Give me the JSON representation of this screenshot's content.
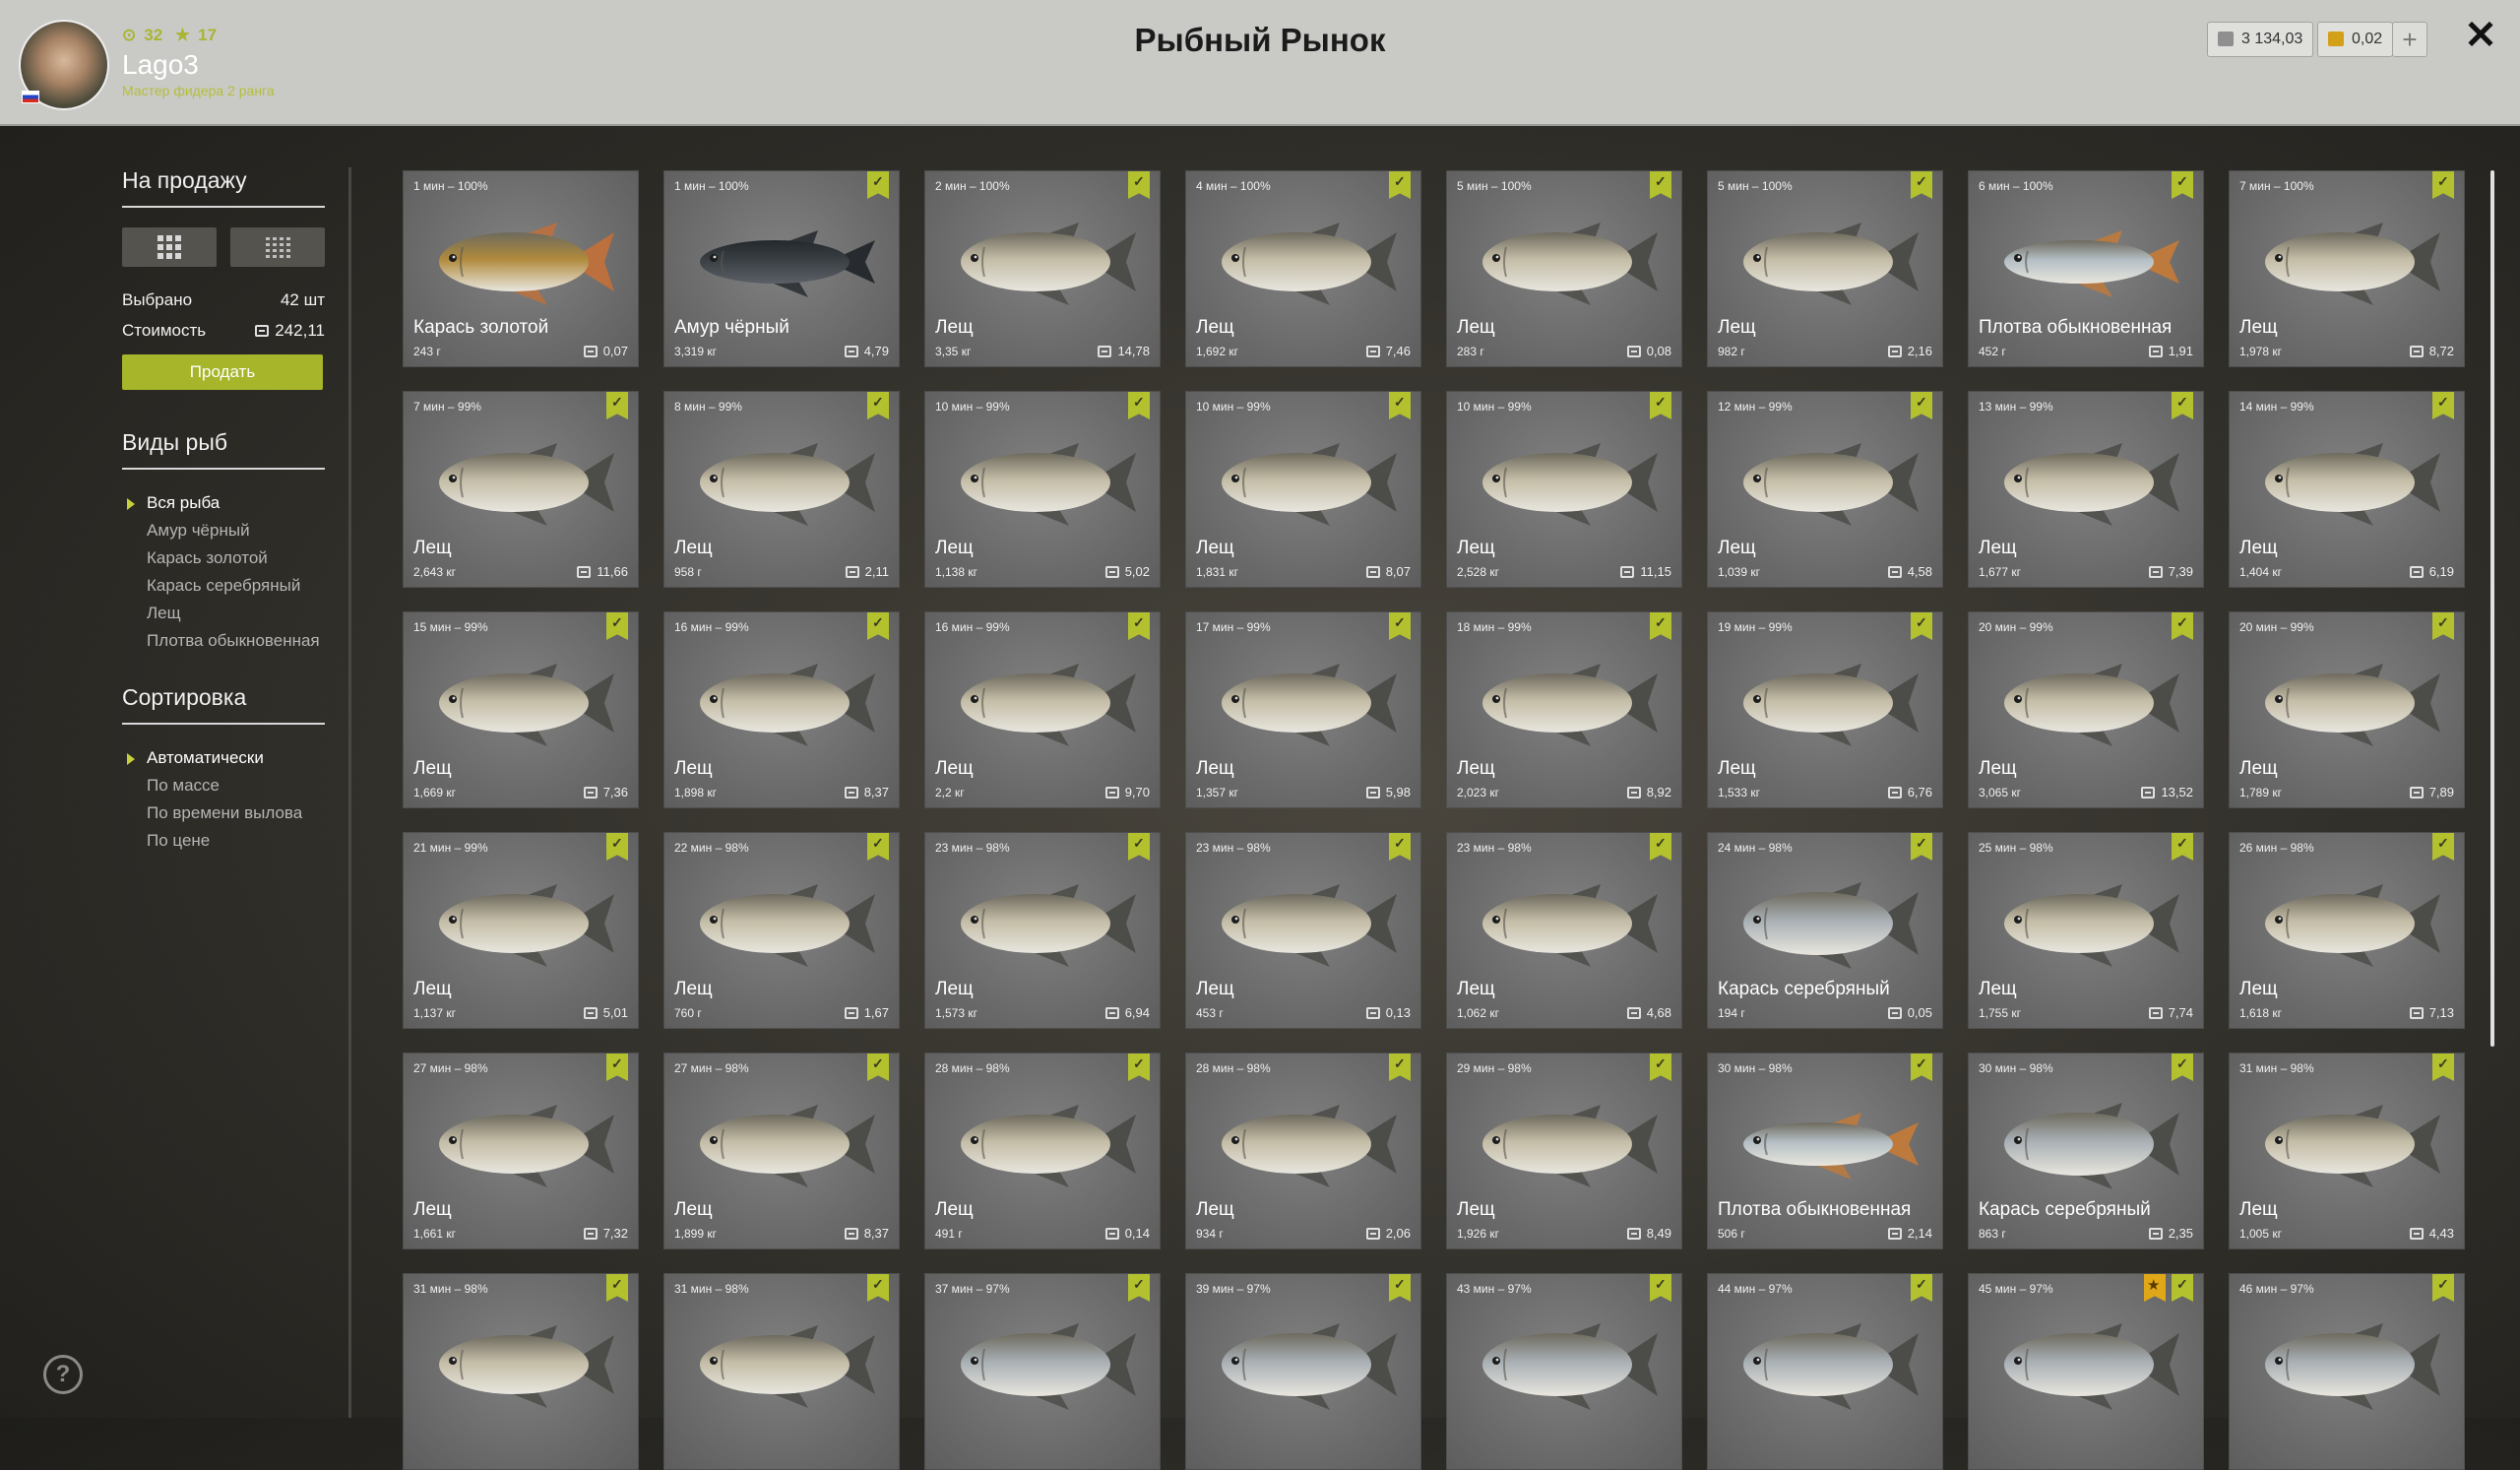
{
  "header": {
    "title": "Рыбный Рынок",
    "player": {
      "name": "Lago3",
      "level": "32",
      "stars": "17",
      "rank": "Мастер фидера 2 ранга"
    },
    "currency": [
      {
        "value": "3 134,03",
        "icon": "silver-icon",
        "color": "#8f8f8f"
      },
      {
        "value": "0,02",
        "icon": "gold-icon",
        "color": "#d2a019"
      }
    ],
    "plus_label": "+",
    "close_label": "✕"
  },
  "sidebar": {
    "sale_title": "На продажу",
    "selected_label": "Выбрано",
    "selected_value": "42 шт",
    "cost_label": "Стоимость",
    "cost_value": "242,11",
    "sell_label": "Продать",
    "species_title": "Виды рыб",
    "species": [
      "Вся рыба",
      "Амур чёрный",
      "Карась золотой",
      "Карась серебряный",
      "Лещ",
      "Плотва обыкновенная"
    ],
    "species_active": 0,
    "sort_title": "Сортировка",
    "sort": [
      "Автоматически",
      "По массе",
      "По времени вылова",
      "По цене"
    ],
    "sort_active": 0
  },
  "help_label": "?",
  "fish_colors": {
    "gold": "#b08a3c",
    "dark": "#3a3f44",
    "bream": "#c3bca6",
    "roach": "#b4bec4",
    "silver": "#a8afb4"
  },
  "cards": [
    {
      "time": "1 мин – 100%",
      "name": "Карась золотой",
      "weight": "243 г",
      "price": "0,07",
      "kind": "gold",
      "check": false
    },
    {
      "time": "1 мин – 100%",
      "name": "Амур чёрный",
      "weight": "3,319 кг",
      "price": "4,79",
      "kind": "dark",
      "check": true
    },
    {
      "time": "2 мин – 100%",
      "name": "Лещ",
      "weight": "3,35 кг",
      "price": "14,78",
      "kind": "bream",
      "check": true
    },
    {
      "time": "4 мин – 100%",
      "name": "Лещ",
      "weight": "1,692 кг",
      "price": "7,46",
      "kind": "bream",
      "check": true
    },
    {
      "time": "5 мин – 100%",
      "name": "Лещ",
      "weight": "283 г",
      "price": "0,08",
      "kind": "bream",
      "check": true
    },
    {
      "time": "5 мин – 100%",
      "name": "Лещ",
      "weight": "982 г",
      "price": "2,16",
      "kind": "bream",
      "check": true
    },
    {
      "time": "6 мин – 100%",
      "name": "Плотва обыкновенная",
      "weight": "452 г",
      "price": "1,91",
      "kind": "roach",
      "check": true
    },
    {
      "time": "7 мин – 100%",
      "name": "Лещ",
      "weight": "1,978 кг",
      "price": "8,72",
      "kind": "bream",
      "check": true
    },
    {
      "time": "7 мин – 99%",
      "name": "Лещ",
      "weight": "2,643 кг",
      "price": "11,66",
      "kind": "bream",
      "check": true
    },
    {
      "time": "8 мин – 99%",
      "name": "Лещ",
      "weight": "958 г",
      "price": "2,11",
      "kind": "bream",
      "check": true
    },
    {
      "time": "10 мин – 99%",
      "name": "Лещ",
      "weight": "1,138 кг",
      "price": "5,02",
      "kind": "bream",
      "check": true
    },
    {
      "time": "10 мин – 99%",
      "name": "Лещ",
      "weight": "1,831 кг",
      "price": "8,07",
      "kind": "bream",
      "check": true
    },
    {
      "time": "10 мин – 99%",
      "name": "Лещ",
      "weight": "2,528 кг",
      "price": "11,15",
      "kind": "bream",
      "check": true
    },
    {
      "time": "12 мин – 99%",
      "name": "Лещ",
      "weight": "1,039 кг",
      "price": "4,58",
      "kind": "bream",
      "check": true
    },
    {
      "time": "13 мин – 99%",
      "name": "Лещ",
      "weight": "1,677 кг",
      "price": "7,39",
      "kind": "bream",
      "check": true
    },
    {
      "time": "14 мин – 99%",
      "name": "Лещ",
      "weight": "1,404 кг",
      "price": "6,19",
      "kind": "bream",
      "check": true
    },
    {
      "time": "15 мин – 99%",
      "name": "Лещ",
      "weight": "1,669 кг",
      "price": "7,36",
      "kind": "bream",
      "check": true
    },
    {
      "time": "16 мин – 99%",
      "name": "Лещ",
      "weight": "1,898 кг",
      "price": "8,37",
      "kind": "bream",
      "check": true
    },
    {
      "time": "16 мин – 99%",
      "name": "Лещ",
      "weight": "2,2 кг",
      "price": "9,70",
      "kind": "bream",
      "check": true
    },
    {
      "time": "17 мин – 99%",
      "name": "Лещ",
      "weight": "1,357 кг",
      "price": "5,98",
      "kind": "bream",
      "check": true
    },
    {
      "time": "18 мин – 99%",
      "name": "Лещ",
      "weight": "2,023 кг",
      "price": "8,92",
      "kind": "bream",
      "check": true
    },
    {
      "time": "19 мин – 99%",
      "name": "Лещ",
      "weight": "1,533 кг",
      "price": "6,76",
      "kind": "bream",
      "check": true
    },
    {
      "time": "20 мин – 99%",
      "name": "Лещ",
      "weight": "3,065 кг",
      "price": "13,52",
      "kind": "bream",
      "check": true
    },
    {
      "time": "20 мин – 99%",
      "name": "Лещ",
      "weight": "1,789 кг",
      "price": "7,89",
      "kind": "bream",
      "check": true
    },
    {
      "time": "21 мин – 99%",
      "name": "Лещ",
      "weight": "1,137 кг",
      "price": "5,01",
      "kind": "bream",
      "check": true
    },
    {
      "time": "22 мин – 98%",
      "name": "Лещ",
      "weight": "760 г",
      "price": "1,67",
      "kind": "bream",
      "check": true
    },
    {
      "time": "23 мин – 98%",
      "name": "Лещ",
      "weight": "1,573 кг",
      "price": "6,94",
      "kind": "bream",
      "check": true
    },
    {
      "time": "23 мин – 98%",
      "name": "Лещ",
      "weight": "453 г",
      "price": "0,13",
      "kind": "bream",
      "check": true
    },
    {
      "time": "23 мин – 98%",
      "name": "Лещ",
      "weight": "1,062 кг",
      "price": "4,68",
      "kind": "bream",
      "check": true
    },
    {
      "time": "24 мин – 98%",
      "name": "Карась серебряный",
      "weight": "194 г",
      "price": "0,05",
      "kind": "silver",
      "check": true
    },
    {
      "time": "25 мин – 98%",
      "name": "Лещ",
      "weight": "1,755 кг",
      "price": "7,74",
      "kind": "bream",
      "check": true
    },
    {
      "time": "26 мин – 98%",
      "name": "Лещ",
      "weight": "1,618 кг",
      "price": "7,13",
      "kind": "bream",
      "check": true
    },
    {
      "time": "27 мин – 98%",
      "name": "Лещ",
      "weight": "1,661 кг",
      "price": "7,32",
      "kind": "bream",
      "check": true
    },
    {
      "time": "27 мин – 98%",
      "name": "Лещ",
      "weight": "1,899 кг",
      "price": "8,37",
      "kind": "bream",
      "check": true
    },
    {
      "time": "28 мин – 98%",
      "name": "Лещ",
      "weight": "491 г",
      "price": "0,14",
      "kind": "bream",
      "check": true
    },
    {
      "time": "28 мин – 98%",
      "name": "Лещ",
      "weight": "934 г",
      "price": "2,06",
      "kind": "bream",
      "check": true
    },
    {
      "time": "29 мин – 98%",
      "name": "Лещ",
      "weight": "1,926 кг",
      "price": "8,49",
      "kind": "bream",
      "check": true
    },
    {
      "time": "30 мин – 98%",
      "name": "Плотва обыкновенная",
      "weight": "506 г",
      "price": "2,14",
      "kind": "roach",
      "check": true
    },
    {
      "time": "30 мин – 98%",
      "name": "Карась серебряный",
      "weight": "863 г",
      "price": "2,35",
      "kind": "silver",
      "check": true
    },
    {
      "time": "31 мин – 98%",
      "name": "Лещ",
      "weight": "1,005 кг",
      "price": "4,43",
      "kind": "bream",
      "check": true
    },
    {
      "time": "31 мин – 98%",
      "name": "",
      "weight": "",
      "price": "",
      "kind": "bream",
      "check": true
    },
    {
      "time": "31 мин – 98%",
      "name": "",
      "weight": "",
      "price": "",
      "kind": "bream",
      "check": true
    },
    {
      "time": "37 мин – 97%",
      "name": "",
      "weight": "",
      "price": "",
      "kind": "silver",
      "check": true
    },
    {
      "time": "39 мин – 97%",
      "name": "",
      "weight": "",
      "price": "",
      "kind": "silver",
      "check": true
    },
    {
      "time": "43 мин – 97%",
      "name": "",
      "weight": "",
      "price": "",
      "kind": "silver",
      "check": true
    },
    {
      "time": "44 мин – 97%",
      "name": "",
      "weight": "",
      "price": "",
      "kind": "silver",
      "check": true
    },
    {
      "time": "45 мин – 97%",
      "name": "",
      "weight": "",
      "price": "",
      "kind": "silver",
      "check": true,
      "star": true
    },
    {
      "time": "46 мин – 97%",
      "name": "",
      "weight": "",
      "price": "",
      "kind": "silver",
      "check": true
    }
  ]
}
